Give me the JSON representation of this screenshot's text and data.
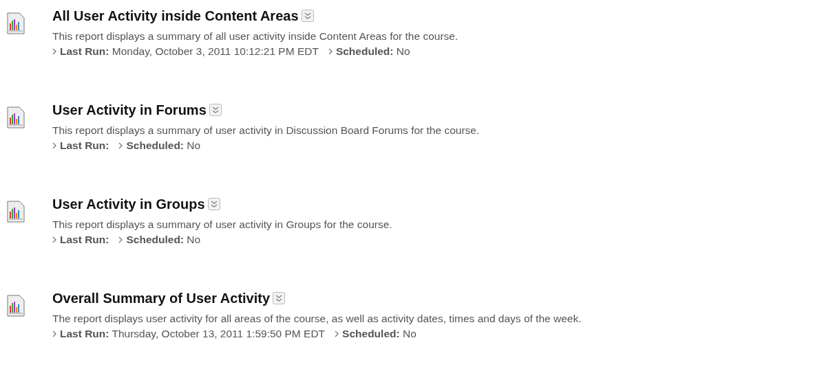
{
  "reports": [
    {
      "title": "All User Activity inside Content Areas",
      "description": "This report displays a summary of all user activity inside Content Areas for the course.",
      "meta": [
        "**Last Run:** Monday, October 3, 2011 10:12:21 PM EDT",
        "**Scheduled:** No"
      ]
    },
    {
      "title": "User Activity in Forums",
      "description": "This report displays a summary of user activity in Discussion Board Forums for the course.",
      "meta": [
        "**Last Run:**",
        "**Scheduled:** No"
      ]
    },
    {
      "title": "User Activity in Groups",
      "description": "This report displays a summary of user activity in Groups for the course.",
      "meta": [
        "**Last Run:**",
        "**Scheduled:** No"
      ]
    },
    {
      "title": "Overall Summary of User Activity",
      "description": "The report displays user activity for all areas of the course, as well as activity dates, times and days of the week.",
      "meta": [
        "**Last Run:** Thursday, October 13, 2011 1:59:50 PM EDT",
        "**Scheduled:** No"
      ]
    }
  ]
}
